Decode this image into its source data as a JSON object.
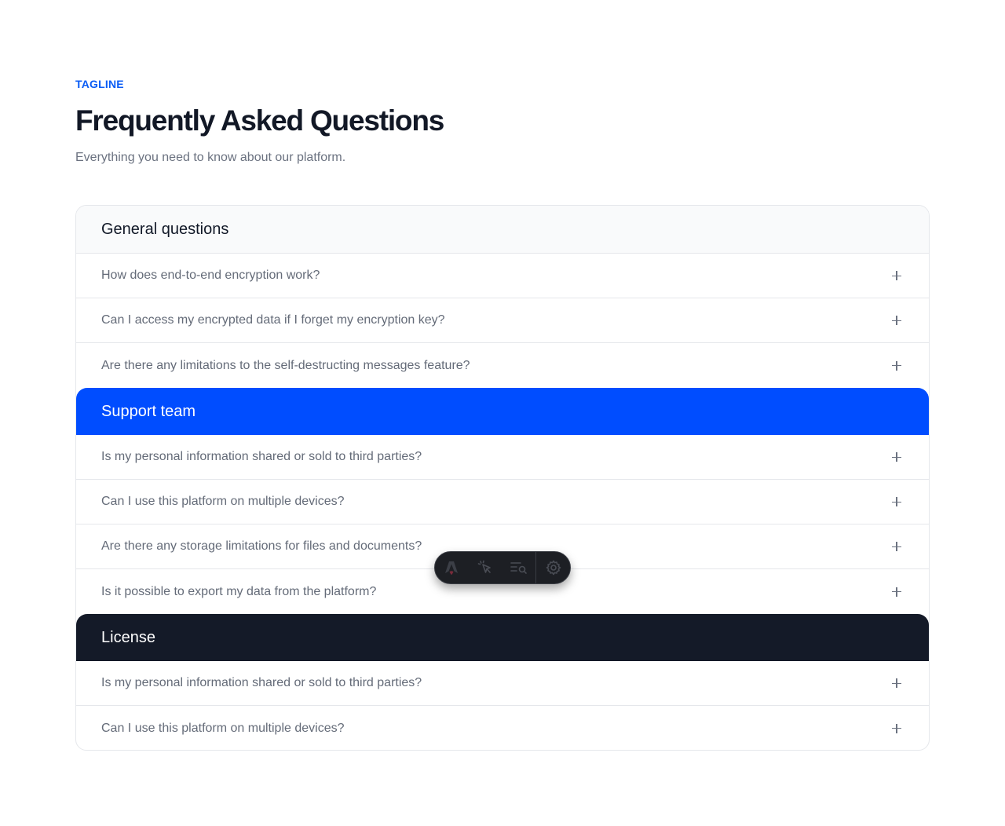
{
  "header": {
    "tagline": "TAGLINE",
    "title": "Frequently Asked Questions",
    "subtitle": "Everything you need to know about our platform."
  },
  "faq": {
    "sections": [
      {
        "title": "General questions",
        "questions": [
          "How does end-to-end encryption work?",
          "Can I access my encrypted data if I forget my encryption key?",
          "Are there any limitations to the self-destructing messages feature?"
        ]
      },
      {
        "title": "Support team",
        "questions": [
          "Is my personal information shared or sold to third parties?",
          "Can I use this platform on multiple devices?",
          "Are there any storage limitations for files and documents?",
          "Is it possible to export my data from the platform?"
        ]
      },
      {
        "title": "License",
        "questions": [
          "Is my personal information shared or sold to third parties?",
          "Can I use this platform on multiple devices?"
        ]
      }
    ],
    "expand_icon": "plus-icon"
  },
  "toolbar": {
    "icons": [
      "astro-logo-icon",
      "cursor-inspect-icon",
      "search-list-icon",
      "gear-icon"
    ]
  },
  "colors": {
    "accent": "#0a5cf5",
    "support_header": "#004dff",
    "license_header": "#141a28",
    "general_header": "#f9fafb",
    "question_text": "#646b78"
  }
}
